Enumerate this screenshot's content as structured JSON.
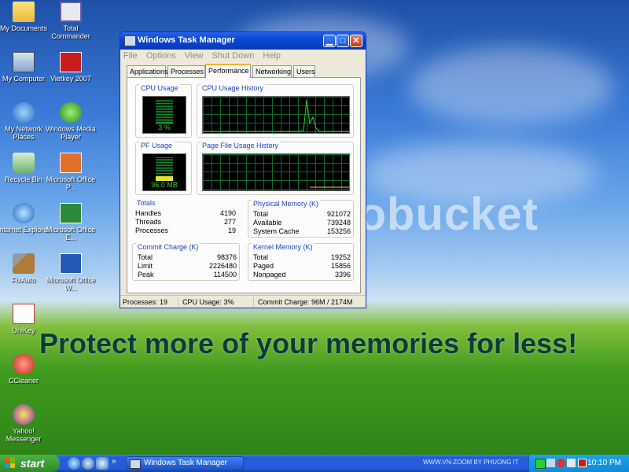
{
  "desktop": {
    "icons": [
      {
        "label": "My Documents"
      },
      {
        "label": "Total Commander"
      },
      {
        "label": "My Computer"
      },
      {
        "label": "Vietkey 2007"
      },
      {
        "label": "My Network Places"
      },
      {
        "label": "Windows Media Player"
      },
      {
        "label": "Recycle Bin"
      },
      {
        "label": "Microsoft Office P..."
      },
      {
        "label": "Internet Explorer"
      },
      {
        "label": "Microsoft Office E..."
      },
      {
        "label": "FixAuto"
      },
      {
        "label": "Microsoft Office W..."
      },
      {
        "label": "UniKey"
      },
      {
        "label": "CCleaner"
      },
      {
        "label": "Yahoo! Messenger"
      }
    ],
    "watermark": "photobucket",
    "banner": "Protect more of your memories for less!"
  },
  "task_manager": {
    "title": "Windows Task Manager",
    "menu": [
      "File",
      "Options",
      "View",
      "Shut Down",
      "Help"
    ],
    "tabs": [
      "Applications",
      "Processes",
      "Performance",
      "Networking",
      "Users"
    ],
    "active_tab": "Performance",
    "cpu_usage": {
      "title": "CPU Usage",
      "value": "3 %",
      "fraction": 0.03
    },
    "cpu_history": {
      "title": "CPU Usage History"
    },
    "pf_usage": {
      "title": "PF Usage",
      "value": "96.0 MB"
    },
    "pf_history": {
      "title": "Page File Usage History"
    },
    "totals": {
      "title": "Totals",
      "rows": [
        {
          "label": "Handles",
          "value": "4190"
        },
        {
          "label": "Threads",
          "value": "277"
        },
        {
          "label": "Processes",
          "value": "19"
        }
      ]
    },
    "physical_memory": {
      "title": "Physical Memory (K)",
      "rows": [
        {
          "label": "Total",
          "value": "921072"
        },
        {
          "label": "Available",
          "value": "739248"
        },
        {
          "label": "System Cache",
          "value": "153256"
        }
      ]
    },
    "commit_charge": {
      "title": "Commit Charge (K)",
      "rows": [
        {
          "label": "Total",
          "value": "98376"
        },
        {
          "label": "Limit",
          "value": "2226480"
        },
        {
          "label": "Peak",
          "value": "114500"
        }
      ]
    },
    "kernel_memory": {
      "title": "Kernel Memory (K)",
      "rows": [
        {
          "label": "Total",
          "value": "19252"
        },
        {
          "label": "Paged",
          "value": "15856"
        },
        {
          "label": "Nonpaged",
          "value": "3396"
        }
      ]
    },
    "status": {
      "processes": "Processes: 19",
      "cpu": "CPU Usage: 3%",
      "commit": "Commit Charge: 96M / 2174M"
    }
  },
  "taskbar": {
    "start": "start",
    "task_button": "Windows Task Manager",
    "note": "WWW.VN-ZOOM BY PHUONG IT",
    "clock": "10:10 PM",
    "overflow": "»"
  },
  "colors": {
    "meter_green": "#2bd12b",
    "xp_blue": "#245ddb",
    "start_green": "#3b9e36"
  }
}
